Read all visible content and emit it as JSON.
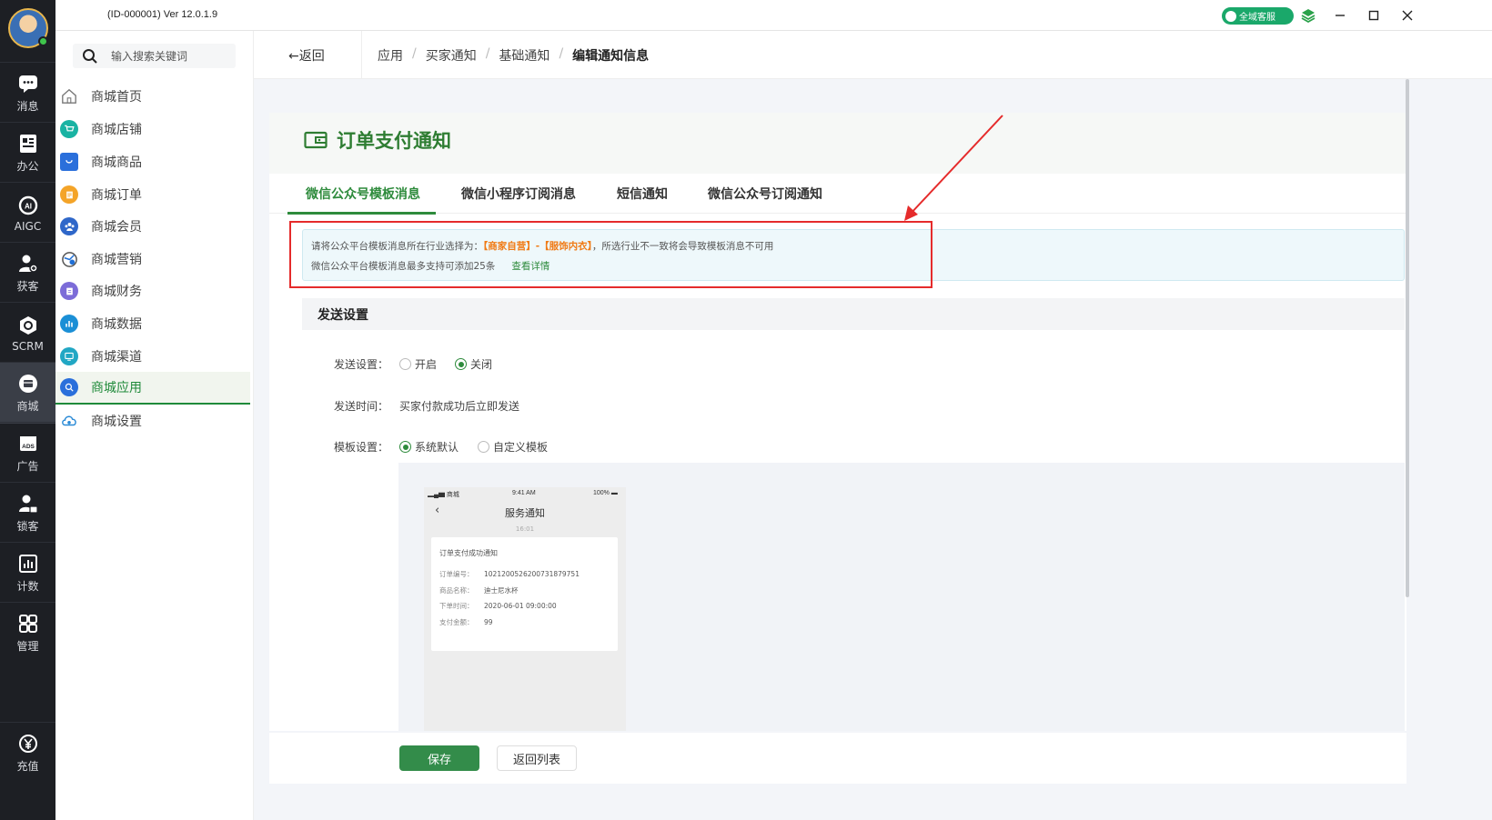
{
  "window": {
    "version_label": "(ID-000001)  Ver 12.0.1.9",
    "service_button": "全域客服"
  },
  "rail": {
    "items": [
      {
        "label": "消息",
        "icon": "chat-icon"
      },
      {
        "label": "办公",
        "icon": "office-icon"
      },
      {
        "label": "AIGC",
        "icon": "aigc-icon"
      },
      {
        "label": "获客",
        "icon": "user-add-icon"
      },
      {
        "label": "SCRM",
        "icon": "scrm-icon"
      },
      {
        "label": "商城",
        "icon": "shop-icon"
      },
      {
        "label": "广告",
        "icon": "ads-icon"
      },
      {
        "label": "锁客",
        "icon": "user-lock-icon"
      },
      {
        "label": "计数",
        "icon": "stats-icon"
      },
      {
        "label": "管理",
        "icon": "grid-icon"
      }
    ],
    "recharge": {
      "label": "充值",
      "icon": "yen-icon"
    }
  },
  "sidebar": {
    "search_placeholder": "输入搜索关键词",
    "items": [
      {
        "label": "商城首页",
        "icon": "home-icon",
        "color": "#888888"
      },
      {
        "label": "商城店铺",
        "icon": "cart-icon",
        "color": "#19b3a3"
      },
      {
        "label": "商城商品",
        "icon": "bag-icon",
        "color": "#2a6fdb"
      },
      {
        "label": "商城订单",
        "icon": "order-icon",
        "color": "#f4a428"
      },
      {
        "label": "商城会员",
        "icon": "members-icon",
        "color": "#2f67c9"
      },
      {
        "label": "商城营销",
        "icon": "marketing-icon",
        "color": "#555555"
      },
      {
        "label": "商城财务",
        "icon": "finance-icon",
        "color": "#7c6cd8"
      },
      {
        "label": "商城数据",
        "icon": "data-icon",
        "color": "#1b8fd6"
      },
      {
        "label": "商城渠道",
        "icon": "channel-icon",
        "color": "#21a7c4"
      },
      {
        "label": "商城应用",
        "icon": "apps-icon",
        "color": "#2a6fdb"
      },
      {
        "label": "商城设置",
        "icon": "settings-cloud-icon",
        "color": "#2a8ad6"
      }
    ],
    "active_index": 9
  },
  "header": {
    "back_label": "返回",
    "breadcrumb": [
      "应用",
      "买家通知",
      "基础通知",
      "编辑通知信息"
    ]
  },
  "page": {
    "title": "订单支付通知",
    "tabs": [
      "微信公众号模板消息",
      "微信小程序订阅消息",
      "短信通知",
      "微信公众号订阅通知"
    ],
    "active_tab": 0,
    "notice": {
      "line1_prefix": "请将公众平台模板消息所在行业选择为：",
      "line1_highlight": "【商家自营】-【服饰内衣】",
      "line1_suffix": "，所选行业不一致将会导致模板消息不可用",
      "line2": "微信公众平台模板消息最多支持可添加25条",
      "link": "查看详情"
    },
    "section_title": "发送设置",
    "send_setting": {
      "label": "发送设置：",
      "options": [
        "开启",
        "关闭"
      ],
      "selected": "关闭"
    },
    "send_time": {
      "label": "发送时间：",
      "value": "买家付款成功后立即发送"
    },
    "template_setting": {
      "label": "模板设置：",
      "options": [
        "系统默认",
        "自定义模板"
      ],
      "selected": "系统默认"
    },
    "preview": {
      "status_left": "商城",
      "status_time": "9:41 AM",
      "status_right": "100%",
      "title": "服务通知",
      "time": "16:01",
      "message_title": "订单支付成功通知",
      "rows": [
        {
          "k": "订单编号：",
          "v": "10212005262007318797​51"
        },
        {
          "k": "商品名称：",
          "v": "迪士尼水杯"
        },
        {
          "k": "下单时间：",
          "v": "2020-06-01 09:00:00"
        },
        {
          "k": "支付金额：",
          "v": "99"
        }
      ]
    },
    "buttons": {
      "save": "保存",
      "back_list": "返回列表"
    }
  },
  "colors": {
    "brand_green": "#2e8b3c",
    "highlight_orange": "#f07b16",
    "annotation_red": "#e52b2b",
    "rail_bg": "#1d1f24"
  }
}
